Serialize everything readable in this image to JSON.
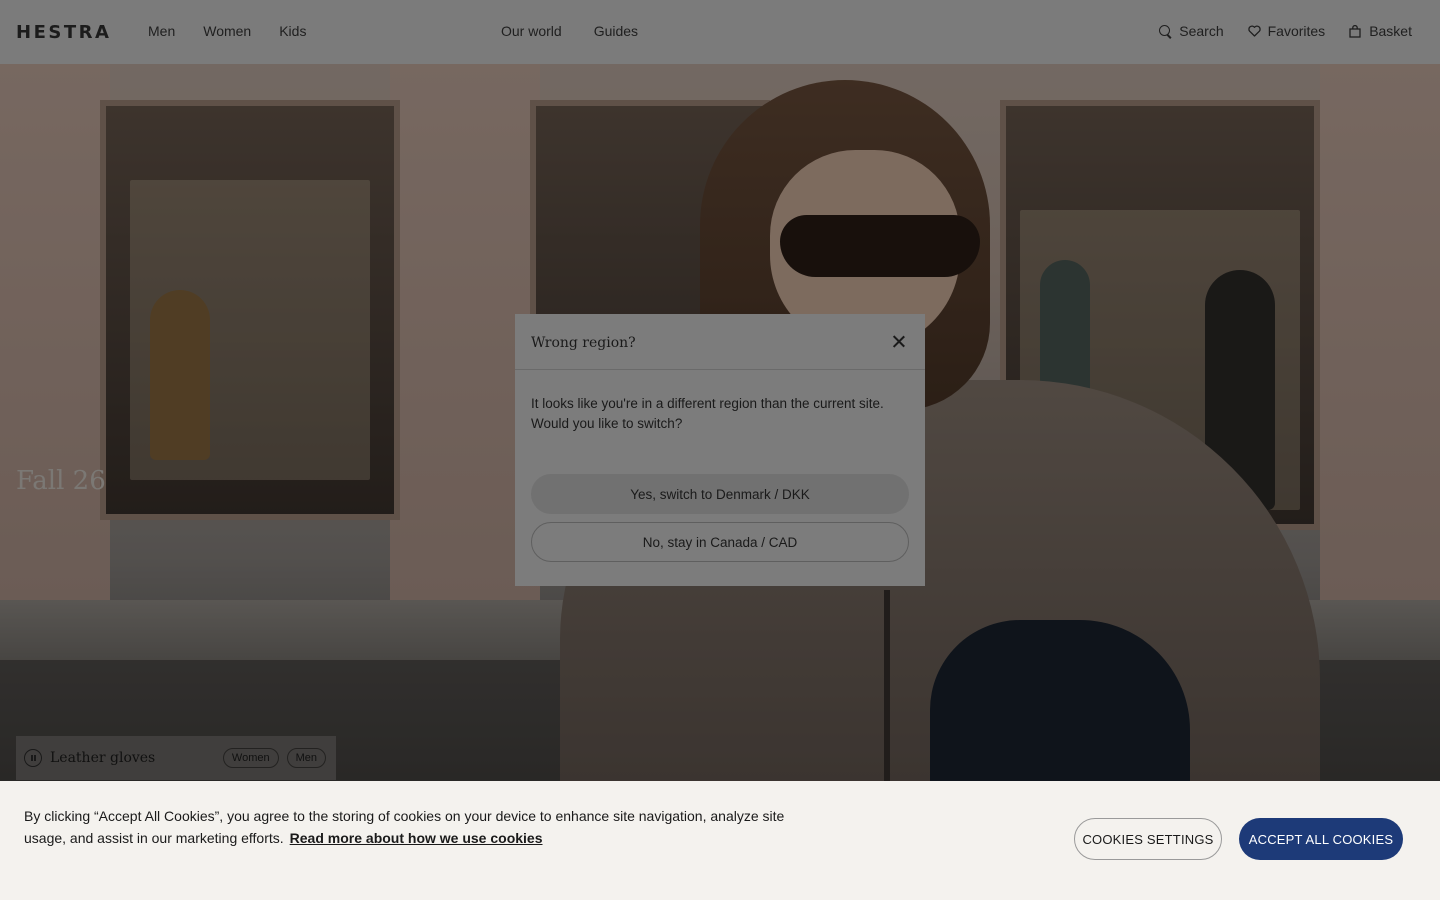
{
  "header": {
    "logo": "HESTRA",
    "nav_left": [
      "Men",
      "Women",
      "Kids"
    ],
    "nav_center": [
      "Our world",
      "Guides"
    ],
    "search_label": "Search",
    "favorites_label": "Favorites",
    "basket_label": "Basket"
  },
  "hero": {
    "title": "Fall 26"
  },
  "gloves_chip": {
    "label": "Leather gloves",
    "tags": [
      "Women",
      "Men"
    ]
  },
  "modal": {
    "title": "Wrong region?",
    "body": "It looks like you're in a different region than the current site. Would you like to switch?",
    "primary_button": "Yes, switch to Denmark / DKK",
    "secondary_button": "No, stay in Canada / CAD"
  },
  "cookie_banner": {
    "text": "By clicking “Accept All Cookies”, you agree to the storing of cookies on your device to enhance site navigation, analyze site usage, and assist in our marketing efforts.",
    "link_text": "Read more about how we use cookies",
    "settings_button": "COOKIES SETTINGS",
    "accept_button": "ACCEPT ALL COOKIES"
  },
  "colors": {
    "accept_button_bg": "#1d3a78",
    "cookie_banner_bg": "#f4f2ee"
  }
}
